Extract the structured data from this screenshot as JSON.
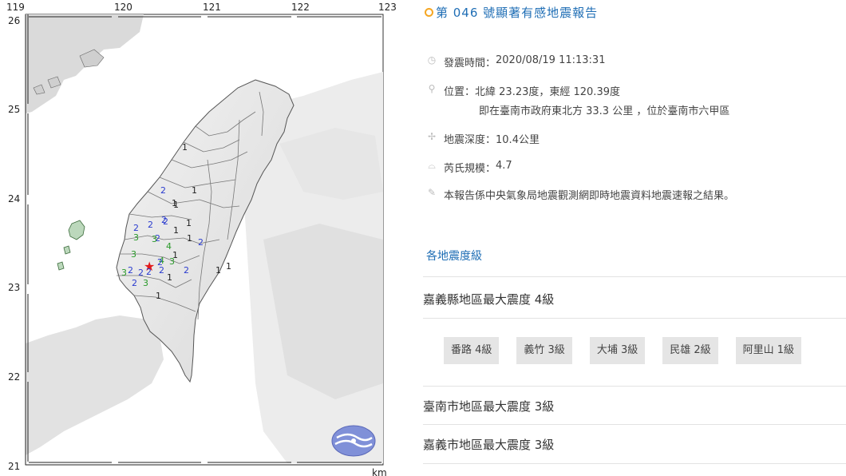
{
  "map": {
    "lon_ticks": [
      "119",
      "120",
      "121",
      "122",
      "123"
    ],
    "lat_ticks": [
      "26",
      "25",
      "24",
      "23",
      "22",
      "21"
    ],
    "scale_unit": "km",
    "epicenter_symbol": "★",
    "intensity_marks": [
      {
        "v": "1",
        "c": "#222"
      },
      {
        "v": "2",
        "c": "#2a3bcf"
      },
      {
        "v": "1",
        "c": "#222"
      },
      {
        "v": "1",
        "c": "#222"
      },
      {
        "v": "2",
        "c": "#2a3bcf"
      },
      {
        "v": "2",
        "c": "#2a3bcf"
      },
      {
        "v": "1",
        "c": "#222"
      },
      {
        "v": "1",
        "c": "#222"
      },
      {
        "v": "3",
        "c": "#2a9a2a"
      },
      {
        "v": "2",
        "c": "#2a3bcf"
      },
      {
        "v": "1",
        "c": "#222"
      },
      {
        "v": "2",
        "c": "#2a3bcf"
      },
      {
        "v": "3",
        "c": "#2a9a2a"
      },
      {
        "v": "2",
        "c": "#2a3bcf"
      },
      {
        "v": "4",
        "c": "#2a9a2a"
      },
      {
        "v": "3",
        "c": "#2a9a2a"
      },
      {
        "v": "1",
        "c": "#222"
      },
      {
        "v": "2",
        "c": "#2a3bcf"
      },
      {
        "v": "2",
        "c": "#2a3bcf"
      },
      {
        "v": "2",
        "c": "#2a3bcf"
      },
      {
        "v": "4",
        "c": "#2a9a2a"
      },
      {
        "v": "2",
        "c": "#2a3bcf"
      },
      {
        "v": "2",
        "c": "#2a3bcf"
      },
      {
        "v": "1",
        "c": "#222"
      },
      {
        "v": "1",
        "c": "#222"
      },
      {
        "v": "3",
        "c": "#2a9a2a"
      },
      {
        "v": "2",
        "c": "#2a3bcf"
      },
      {
        "v": "2",
        "c": "#2a3bcf"
      },
      {
        "v": "2",
        "c": "#2a3bcf"
      },
      {
        "v": "3",
        "c": "#2a9a2a"
      },
      {
        "v": "1",
        "c": "#222"
      },
      {
        "v": "1",
        "c": "#222"
      },
      {
        "v": "1",
        "c": "#222"
      },
      {
        "v": "3",
        "c": "#2a9a2a"
      }
    ]
  },
  "report": {
    "title": "第 046 號顯著有感地震報告",
    "time_label": "發震時間：",
    "time_value": "2020/08/19 11:13:31",
    "location_label": "位置：",
    "location_value": "北緯 23.23度，東經 120.39度",
    "location_detail": "即在臺南市政府東北方 33.3 公里 ，位於臺南市六甲區",
    "depth_label": "地震深度：",
    "depth_value": "10.4公里",
    "magnitude_label": "芮氏規模：",
    "magnitude_value": "4.7",
    "note": "本報告係中央氣象局地震觀測網即時地震資料地震速報之結果。",
    "section_title": "各地震度級",
    "areas": [
      {
        "label": "嘉義縣地區最大震度 4級"
      },
      {
        "label": "臺南市地區最大震度 3級"
      },
      {
        "label": "嘉義市地區最大震度 3級"
      }
    ],
    "stations": [
      "番路 4級",
      "義竹 3級",
      "大埔 3級",
      "民雄 2級",
      "阿里山 1級"
    ]
  }
}
